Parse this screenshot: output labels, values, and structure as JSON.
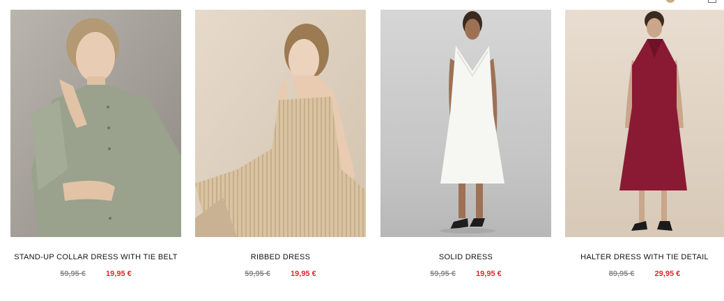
{
  "products": [
    {
      "name": "STAND-UP COLLAR DRESS WITH TIE BELT",
      "old_price": "59,95 €",
      "new_price": "19,95 €",
      "image_icon": "product-photo"
    },
    {
      "name": "RIBBED DRESS",
      "old_price": "59,95 €",
      "new_price": "19,95 €",
      "image_icon": "product-photo"
    },
    {
      "name": "SOLID DRESS",
      "old_price": "59,95 €",
      "new_price": "19,95 €",
      "image_icon": "product-photo"
    },
    {
      "name": "HALTER DRESS WITH TIE DETAIL",
      "old_price": "89,95 €",
      "new_price": "29,95 €",
      "image_icon": "product-photo"
    }
  ],
  "colors": {
    "sale_price": "#e0262b",
    "old_price": "#8a8a8a",
    "text": "#111111"
  }
}
